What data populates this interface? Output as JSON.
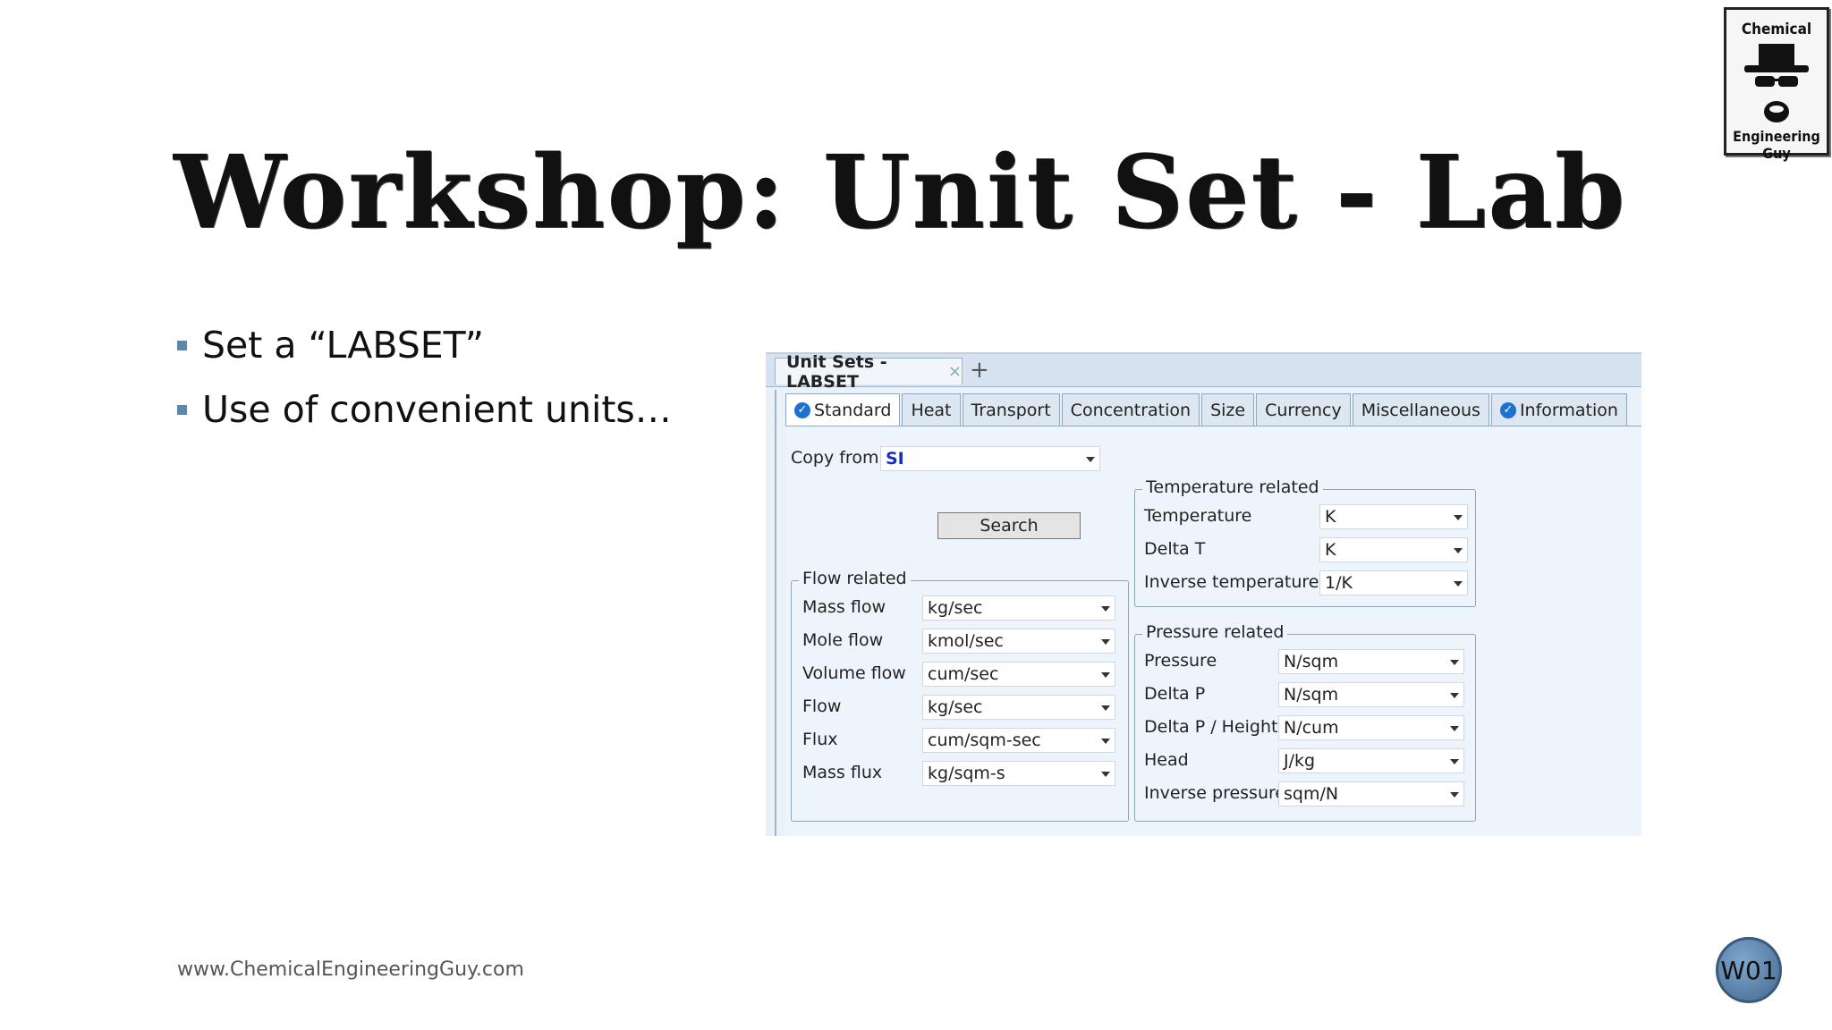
{
  "slide": {
    "title": "Workshop: Unit Set - Lab",
    "bullets": [
      "Set a “LABSET”",
      "Use of convenient units…"
    ],
    "footer_url": "www.ChemicalEngineeringGuy.com",
    "badge": "W01",
    "logo": {
      "top_text": "Chemical",
      "bottom_text": "Engineering Guy",
      "icon": "hat-glasses-beard-icon"
    }
  },
  "app": {
    "doc_tab": {
      "label": "Unit Sets - LABSET",
      "close": "×"
    },
    "add_tab": "+",
    "tabs": [
      {
        "label": "Standard",
        "checked": true
      },
      {
        "label": "Heat"
      },
      {
        "label": "Transport"
      },
      {
        "label": "Concentration"
      },
      {
        "label": "Size"
      },
      {
        "label": "Currency"
      },
      {
        "label": "Miscellaneous"
      },
      {
        "label": "Information",
        "checked": true
      }
    ],
    "copy_from": {
      "label": "Copy from",
      "value": "SI"
    },
    "search_button": "Search",
    "flow": {
      "title": "Flow related",
      "rows": [
        {
          "label": "Mass flow",
          "value": "kg/sec"
        },
        {
          "label": "Mole flow",
          "value": "kmol/sec"
        },
        {
          "label": "Volume flow",
          "value": "cum/sec"
        },
        {
          "label": "Flow",
          "value": "kg/sec"
        },
        {
          "label": "Flux",
          "value": "cum/sqm-sec"
        },
        {
          "label": "Mass flux",
          "value": "kg/sqm-s"
        }
      ]
    },
    "temperature": {
      "title": "Temperature related",
      "rows": [
        {
          "label": "Temperature",
          "value": "K"
        },
        {
          "label": "Delta T",
          "value": "K"
        },
        {
          "label": "Inverse temperature",
          "value": "1/K"
        }
      ]
    },
    "pressure": {
      "title": "Pressure related",
      "rows": [
        {
          "label": "Pressure",
          "value": "N/sqm"
        },
        {
          "label": "Delta P",
          "value": "N/sqm"
        },
        {
          "label": "Delta P / Height",
          "value": "N/cum"
        },
        {
          "label": "Head",
          "value": "J/kg"
        },
        {
          "label": "Inverse pressure",
          "value": "sqm/N"
        }
      ]
    }
  }
}
